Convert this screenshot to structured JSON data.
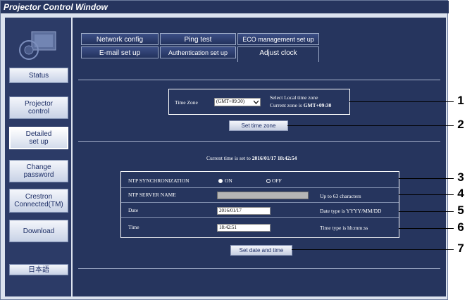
{
  "window": {
    "title": "Projector Control Window"
  },
  "sidebar": {
    "items": [
      {
        "label": "Status"
      },
      {
        "label": "Projector\ncontrol"
      },
      {
        "label": "Detailed\nset up"
      },
      {
        "label": "Change\npassword"
      },
      {
        "label": "Crestron\nConnected(TM)"
      },
      {
        "label": "Download"
      },
      {
        "label": "日本語"
      }
    ],
    "active_index": 2
  },
  "tabs": [
    {
      "label": "Network config"
    },
    {
      "label": "Ping test"
    },
    {
      "label": "ECO management set up"
    },
    {
      "label": "E-mail set up"
    },
    {
      "label": "Authentication set up"
    },
    {
      "label": "Adjust clock"
    }
  ],
  "active_tab": "Adjust clock",
  "timezone": {
    "label": "Time Zone",
    "selected": "(GMT+09:30)",
    "hint_line1": "Select Local time zone",
    "hint_prefix": "Current zone is ",
    "current_zone": "GMT+09:30",
    "button": "Set time zone"
  },
  "clock": {
    "current_prefix": "Current time is set to ",
    "current_time": "2016/01/17 18:42:54"
  },
  "ntp": {
    "sync_label": "NTP SYNCHRONIZATION",
    "on_label": "ON",
    "off_label": "OFF",
    "selected": "ON",
    "server_label": "NTP SERVER NAME",
    "server_value": "",
    "server_hint": "Up to 63 characters"
  },
  "date": {
    "label": "Date",
    "value": "2016/01/17",
    "hint": "Date type is YYYY/MM/DD"
  },
  "time": {
    "label": "Time",
    "value": "18:42:51",
    "hint": "Time type is hh:mm:ss"
  },
  "set_datetime_button": "Set date and time",
  "callouts": [
    "1",
    "2",
    "3",
    "4",
    "5",
    "6",
    "7"
  ],
  "icons": {
    "logo": "projector-logo-icon",
    "radio": "radio-icon",
    "dropdown": "chevron-down-icon"
  }
}
